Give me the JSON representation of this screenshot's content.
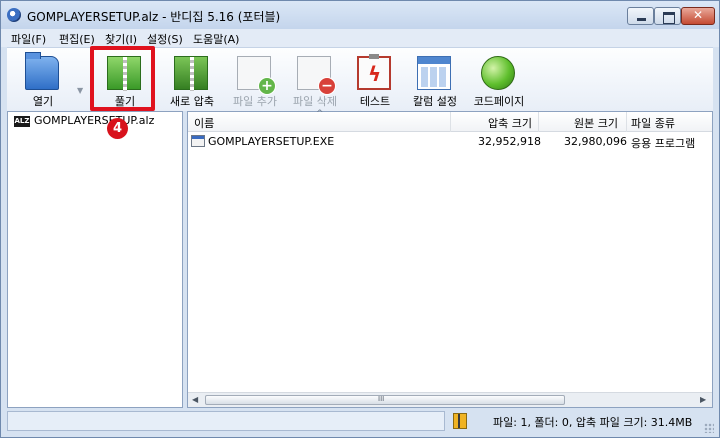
{
  "window": {
    "title": "GOMPLAYERSETUP.alz - 반디집 5.16 (포터블)"
  },
  "menu": [
    "파일(F)",
    "편집(E)",
    "찾기(I)",
    "설정(S)",
    "도움말(A)"
  ],
  "toolbar": {
    "open": "열기",
    "extract": "풀기",
    "new_archive": "새로 압축",
    "add_file": "파일 추가",
    "delete_file": "파일 삭제",
    "test": "테스트",
    "column_settings": "칼럼 설정",
    "homepage": "코드페이지"
  },
  "annotation": {
    "step_number": "4",
    "highlight_color": "#e0121e"
  },
  "tree": {
    "items": [
      {
        "icon": "ALZ",
        "label": "GOMPLAYERSETUP.alz"
      }
    ]
  },
  "list": {
    "columns": [
      "이름",
      "압축 크기",
      "원본 크기",
      "파일 종류"
    ],
    "rows": [
      {
        "name": "GOMPLAYERSETUP.EXE",
        "compressed": "32,952,918",
        "original": "32,980,096",
        "type": "응용 프로그램"
      }
    ]
  },
  "scrollbar": {
    "grip": "III"
  },
  "status": {
    "text": "파일: 1, 폴더: 0, 압축 파일 크기: 31.4MB"
  },
  "icons": [
    "app-icon",
    "open-folder-icon",
    "extract-icon",
    "new-archive-icon",
    "add-file-icon",
    "delete-file-icon",
    "test-icon",
    "column-settings-icon",
    "homepage-icon",
    "archive-status-icon"
  ]
}
